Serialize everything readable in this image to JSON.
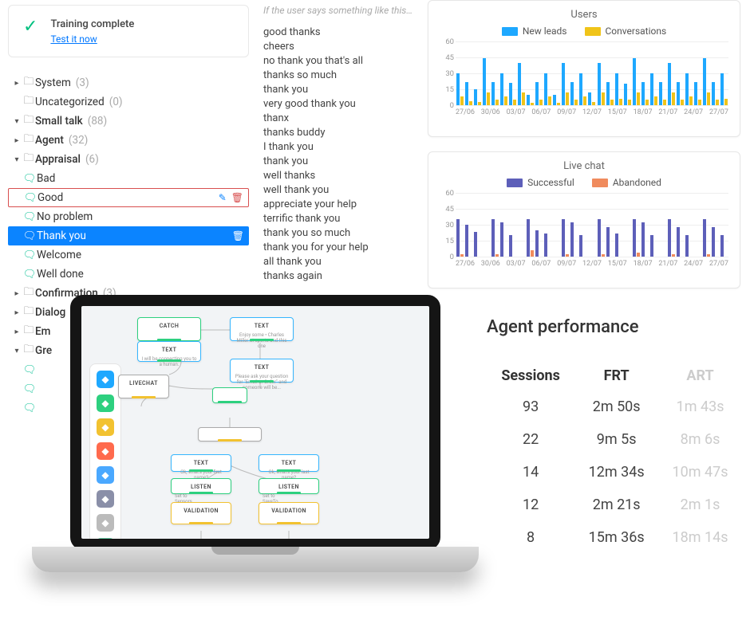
{
  "training": {
    "title": "Training complete",
    "link": "Test it now"
  },
  "tree": {
    "top": [
      {
        "label": "System",
        "count": "(3)"
      },
      {
        "label": "Uncategorized",
        "count": "(0)"
      },
      {
        "label": "Small talk",
        "count": "(88)",
        "open": true
      }
    ],
    "smalltalk": [
      {
        "label": "Agent",
        "count": "(32)"
      },
      {
        "label": "Appraisal",
        "count": "(6)",
        "open": true
      }
    ],
    "appraisal": [
      {
        "label": "Bad"
      },
      {
        "label": "Good",
        "outline": true
      },
      {
        "label": "No problem"
      },
      {
        "label": "Thank you",
        "selected": true
      },
      {
        "label": "Welcome"
      },
      {
        "label": "Well done"
      }
    ],
    "after": [
      {
        "label": "Confirmation",
        "count": "(3)"
      },
      {
        "label": "Dialog",
        "count": ""
      },
      {
        "label": "Em"
      },
      {
        "label": "Gre",
        "open": true
      }
    ]
  },
  "phrases": {
    "header": "If the user says something like this…",
    "items": [
      "good thanks",
      "cheers",
      "no thank you that's all",
      "thanks so much",
      "thank you",
      "very good thank you",
      "thanx",
      "thanks buddy",
      "I thank you",
      "thank you",
      "well thanks",
      "well thank you",
      "appreciate your help",
      "terrific thank you",
      "thank you so much",
      "thank you for your help",
      "all thank you",
      "thanks again"
    ]
  },
  "chart_data": [
    {
      "type": "bar",
      "title": "Users",
      "series": [
        {
          "name": "New leads",
          "color": "#1ea8ff",
          "values": [
            30,
            22,
            15,
            44,
            22,
            30,
            21,
            40,
            10,
            22,
            30,
            10,
            40,
            22,
            30,
            12,
            40,
            22,
            30,
            20,
            44,
            22,
            30,
            22,
            40,
            22,
            30,
            22,
            44,
            22,
            30
          ]
        },
        {
          "name": "Conversations",
          "color": "#f0c419",
          "values": [
            8,
            4,
            3,
            12,
            5,
            8,
            5,
            12,
            2,
            5,
            8,
            2,
            12,
            5,
            8,
            3,
            12,
            5,
            6,
            5,
            12,
            5,
            8,
            5,
            12,
            5,
            8,
            5,
            12,
            5,
            6
          ]
        }
      ],
      "categories": [
        "27/06",
        "",
        "",
        "30/06",
        "",
        "",
        "03/07",
        "",
        "",
        "06/07",
        "",
        "",
        "09/07",
        "",
        "",
        "12/07",
        "",
        "",
        "15/07",
        "",
        "",
        "18/07",
        "",
        "",
        "21/07",
        "",
        "",
        "24/07",
        "",
        "",
        "27/07"
      ],
      "ylim": [
        0,
        60
      ],
      "yticks": [
        0,
        15,
        30,
        45,
        60
      ]
    },
    {
      "type": "bar",
      "title": "Live chat",
      "series": [
        {
          "name": "Successful",
          "color": "#5d5fb9",
          "values": [
            35,
            30,
            23,
            0,
            35,
            32,
            20,
            0,
            35,
            25,
            22,
            0,
            35,
            32,
            20,
            0,
            35,
            28,
            22,
            0,
            35,
            32,
            20,
            0,
            35,
            28,
            20,
            0,
            35,
            28,
            20
          ]
        },
        {
          "name": "Abandoned",
          "color": "#f08b5d",
          "values": [
            2,
            0,
            0,
            0,
            2,
            0,
            0,
            0,
            6,
            0,
            0,
            0,
            2,
            0,
            0,
            0,
            2,
            0,
            0,
            0,
            4,
            0,
            0,
            0,
            2,
            0,
            0,
            0,
            2,
            0,
            0
          ]
        }
      ],
      "categories": [
        "27/06",
        "",
        "",
        "30/06",
        "",
        "",
        "03/07",
        "",
        "",
        "06/07",
        "",
        "",
        "09/07",
        "",
        "",
        "12/07",
        "",
        "",
        "15/07",
        "",
        "",
        "18/07",
        "",
        "",
        "21/07",
        "",
        "",
        "24/07",
        "",
        "",
        "27/07"
      ],
      "ylim": [
        0,
        60
      ],
      "yticks": [
        0,
        15,
        30,
        45,
        60
      ]
    }
  ],
  "perf": {
    "title": "Agent performance",
    "columns": [
      "Sessions",
      "FRT",
      "ART"
    ],
    "rows": [
      {
        "sessions": "93",
        "frt": "2m 50s",
        "art": "1m 43s"
      },
      {
        "sessions": "22",
        "frt": "9m 5s",
        "art": "8m 6s"
      },
      {
        "sessions": "14",
        "frt": "12m 34s",
        "art": "10m 47s"
      },
      {
        "sessions": "12",
        "frt": "2m 21s",
        "art": "2m 1s"
      },
      {
        "sessions": "8",
        "frt": "15m 36s",
        "art": "18m 14s"
      }
    ]
  },
  "flow": {
    "toolbox_colors": [
      "#1ea8ff",
      "#2dd07f",
      "#f2c230",
      "#ff6a4d",
      "#4aa8ff",
      "#8a8fa8",
      "#bbb",
      "#6ad0a8"
    ],
    "nodes": {
      "a": "CATCH",
      "b": "TEXT",
      "c": "TEXT",
      "d": "TEXT",
      "e": "LIVECHAT",
      "f": "",
      "g": "",
      "h": "TEXT",
      "i": "TEXT",
      "j": "LISTEN",
      "k": "LISTEN",
      "l": "VALIDATION",
      "m": "VALIDATION"
    }
  }
}
